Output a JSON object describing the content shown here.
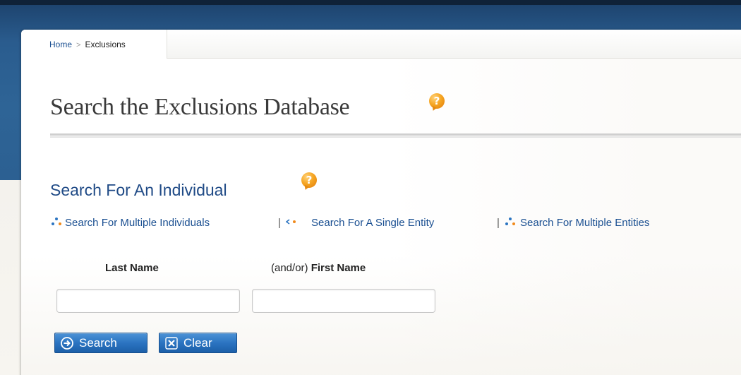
{
  "breadcrumb": {
    "home": "Home",
    "separator": ">",
    "current": "Exclusions"
  },
  "page": {
    "title": "Search the Exclusions Database"
  },
  "section": {
    "title": "Search For An Individual"
  },
  "links": {
    "multiple_individuals": "Search For Multiple Individuals",
    "single_entity": "Search For A Single Entity",
    "multiple_entities": "Search For Multiple Entities",
    "separator": "|"
  },
  "form": {
    "last_name_label": "Last Name",
    "first_name_prefix": "(and/or)",
    "first_name_label": "First Name",
    "last_name_value": "",
    "first_name_value": ""
  },
  "buttons": {
    "search": "Search",
    "clear": "Clear"
  },
  "colors": {
    "header_blue": "#2c6092",
    "link_blue": "#1a4f91",
    "button_blue": "#2b74c1",
    "help_orange": "#f6a623"
  },
  "icons": {
    "title_help": "help-question-bubble-icon",
    "section_help": "help-question-bubble-icon",
    "multiple": "multiple-dots-icon",
    "single": "single-dots-icon",
    "search": "search-arrow-icon",
    "clear": "clear-x-icon"
  }
}
